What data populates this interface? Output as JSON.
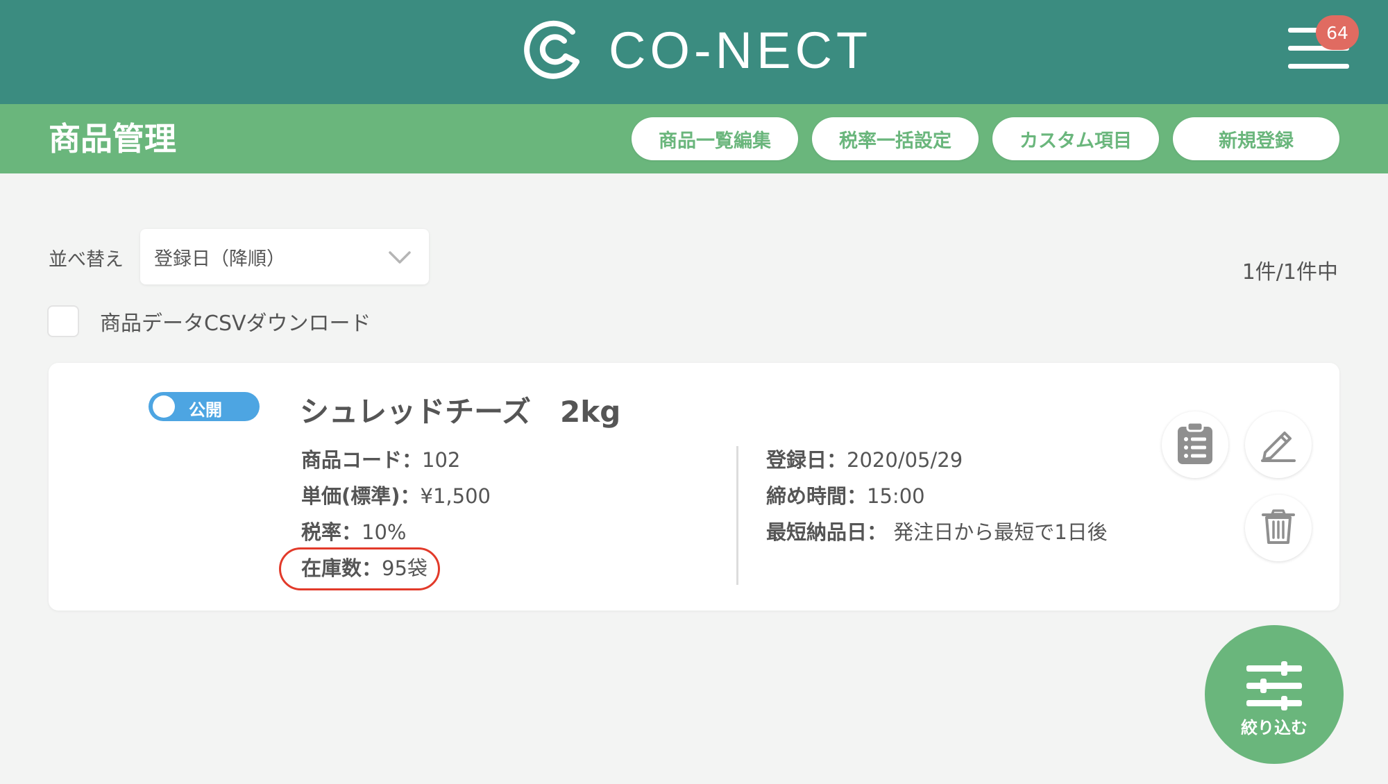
{
  "header": {
    "brand": "CO-NECT",
    "notification_count": "64",
    "logo_icon": "conect-logo-icon",
    "menu_icon": "hamburger-menu-icon"
  },
  "subheader": {
    "title": "商品管理",
    "actions": [
      {
        "label": "商品一覧編集"
      },
      {
        "label": "税率一括設定"
      },
      {
        "label": "カスタム項目"
      },
      {
        "label": "新規登録"
      }
    ]
  },
  "controls": {
    "sort_label": "並べ替え",
    "sort_value": "登録日（降順）",
    "count_text": "1件/1件中",
    "csv_label": "商品データCSVダウンロード"
  },
  "product": {
    "status": "公開",
    "name": "シュレッドチーズ　2kg",
    "code_label": "商品コード：",
    "code": "102",
    "price_label": "単価(標準)：",
    "price": "¥1,500",
    "tax_label": "税率：",
    "tax": "10%",
    "stock_label": "在庫数：",
    "stock": "95袋",
    "registered_label": "登録日：",
    "registered": "2020/05/29",
    "cutoff_label": "締め時間：",
    "cutoff": "15:00",
    "earliest_label": "最短納品日：",
    "earliest": " 発注日から最短で1日後"
  },
  "fab": {
    "label": "絞り込む",
    "icon": "filter-sliders-icon"
  },
  "colors": {
    "header": "#3b8c80",
    "subheader": "#6ab67c",
    "toggle": "#4da5e2",
    "badge": "#e06b61",
    "highlight": "#e23a2a"
  }
}
